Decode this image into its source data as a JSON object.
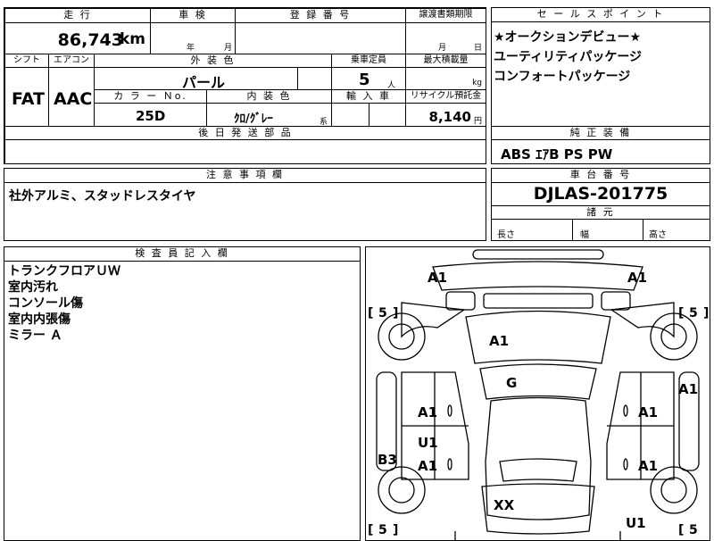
{
  "mileage": {
    "header": "走 行",
    "value": "86,743",
    "unit": "km"
  },
  "inspection": {
    "header": "車 検",
    "year_label": "年",
    "month_label": "月"
  },
  "registration": {
    "header": "登 録 番 号"
  },
  "transfer": {
    "header": "譲渡書類期限",
    "month_label": "月",
    "day_label": "日"
  },
  "selling_points": {
    "header": "セ ー ル ス ポ イ ン ト",
    "lines": [
      "★オークションデビュー★",
      "ユーティリティパッケージ",
      "コンフォートパッケージ"
    ]
  },
  "shift": {
    "header": "シフト",
    "value": "FAT"
  },
  "aircon": {
    "header": "エアコン",
    "value": "AAC"
  },
  "exterior_color": {
    "header": "外 装 色",
    "value": "パール"
  },
  "capacity": {
    "header": "乗車定員",
    "value": "5",
    "unit": "人"
  },
  "max_load": {
    "header": "最大積載量",
    "unit": "kg"
  },
  "color_no": {
    "header": "カ ラ ー Ｎo.",
    "value": "25D"
  },
  "interior_color": {
    "header": "内 装 色",
    "value": "ｸﾛ/ｸﾞﾚｰ",
    "suffix": "系"
  },
  "import": {
    "header": "輸 入 車"
  },
  "recycle": {
    "header": "リサイクル預託金",
    "value": "8,140",
    "unit": "円"
  },
  "later_parts": {
    "header": "後 日 発 送 部 品"
  },
  "equipment": {
    "header": "純 正 装 備",
    "value": "ABS ｴｱB PS PW"
  },
  "notes": {
    "header": "注 意 事 項 欄",
    "value": "社外アルミ、スタッドレスタイヤ"
  },
  "chassis": {
    "header": "車 台 番 号",
    "value": "DJLAS-201775"
  },
  "dimensions": {
    "header": "諸 元",
    "length": "長さ",
    "width": "幅",
    "height": "高さ"
  },
  "inspector": {
    "header": "検 査 員 記 入 欄",
    "lines": [
      "トランクフロアＵＷ",
      "室内汚れ",
      "コンソール傷",
      "室内内張傷",
      "ミラー Ａ"
    ]
  },
  "diagram": {
    "marks": {
      "front_left": "A1",
      "front_right": "A1",
      "windshield": "A1",
      "roof": "G",
      "right_side": "A1",
      "left_front_door": "A1",
      "right_front_door": "A1",
      "left_rear_upper": "U1",
      "left_rear_door": "A1",
      "right_rear_door": "A1",
      "left_sill": "B3",
      "trunk": "XX",
      "rear_right": "U1"
    },
    "tires": {
      "fl_open": "[",
      "fl": "5",
      "fl_close": "]",
      "fr": "5",
      "rl": "5",
      "rr": "5"
    }
  }
}
